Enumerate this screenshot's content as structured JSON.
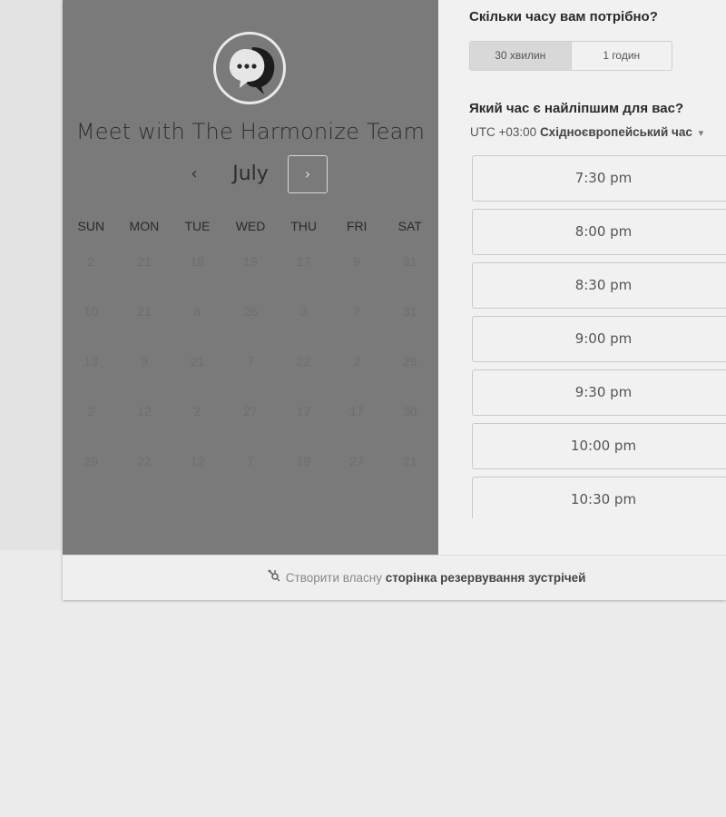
{
  "calendar": {
    "meeting_title": "Meet with The Harmonize Team",
    "month": "July",
    "prev_label": "‹",
    "next_label": "›",
    "weekdays": [
      "SUN",
      "MON",
      "TUE",
      "WED",
      "THU",
      "FRI",
      "SAT"
    ],
    "weeks": [
      [
        "2",
        "21",
        "18",
        "19",
        "17",
        "9",
        "31"
      ],
      [
        "10",
        "21",
        "8",
        "26",
        "3",
        "7",
        "31"
      ],
      [
        "13",
        "9",
        "21",
        "7",
        "22",
        "2",
        "29"
      ],
      [
        "2",
        "12",
        "2",
        "27",
        "17",
        "17",
        "30"
      ],
      [
        "29",
        "22",
        "12",
        "7",
        "19",
        "27",
        "21"
      ]
    ]
  },
  "duration": {
    "question": "Скільки часу вам потрібно?",
    "options": [
      "30 хвилин",
      "1 годин"
    ],
    "selected": "30 хвилин"
  },
  "times": {
    "question": "Який час є найліпшим для вас?",
    "timezone_offset": "UTC +03:00",
    "timezone_name": "Східноєвропейський час",
    "timezone_caret": "▾",
    "slots": [
      "7:30 pm",
      "8:00 pm",
      "8:30 pm",
      "9:00 pm",
      "9:30 pm",
      "10:00 pm",
      "10:30 pm"
    ]
  },
  "footer": {
    "prefix": "Створити власну",
    "link": "сторінка резервування зустрічей",
    "icon": "sprocket-icon"
  },
  "icons": {
    "avatar": "chat-bubble-icon"
  },
  "colors": {
    "left_panel": "#7a7a7a",
    "right_panel": "#f1f1f1",
    "page_bg": "#ececec"
  }
}
